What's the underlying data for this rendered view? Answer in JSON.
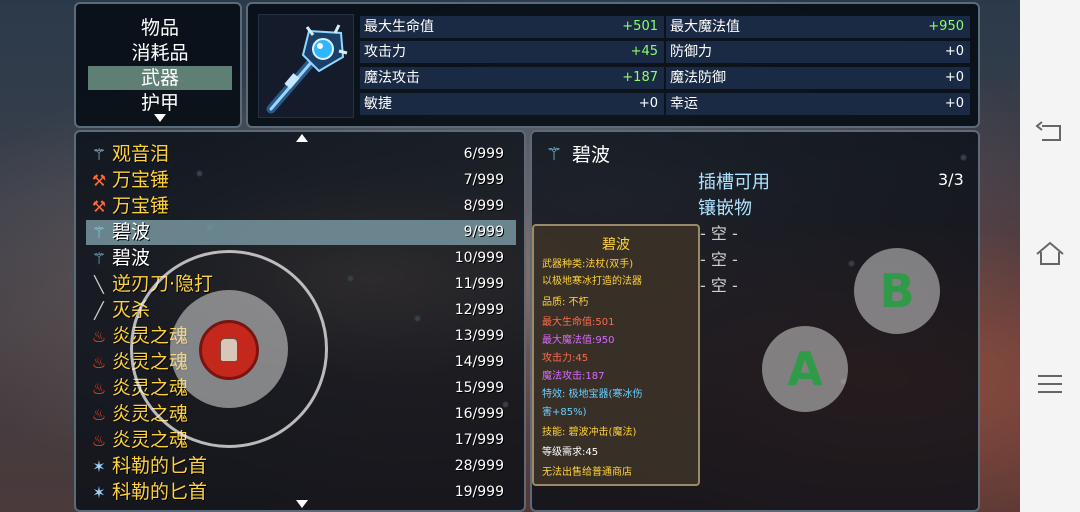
{
  "categories": {
    "items": [
      "物品",
      "消耗品",
      "武器",
      "护甲"
    ],
    "selected_index": 2
  },
  "stats": {
    "rows": [
      {
        "label": "最大生命值",
        "value": "+501"
      },
      {
        "label": "最大魔法值",
        "value": "+950"
      },
      {
        "label": "攻击力",
        "value": "+45"
      },
      {
        "label": "防御力",
        "value": "+0"
      },
      {
        "label": "魔法攻击",
        "value": "+187"
      },
      {
        "label": "魔法防御",
        "value": "+0"
      },
      {
        "label": "敏捷",
        "value": "+0"
      },
      {
        "label": "幸运",
        "value": "+0"
      }
    ]
  },
  "item_list": {
    "items": [
      {
        "icon": "orb-staff-icon",
        "name": "观音泪",
        "count": "6/999"
      },
      {
        "icon": "hammer-icon",
        "name": "万宝锤",
        "count": "7/999"
      },
      {
        "icon": "hammer-icon",
        "name": "万宝锤",
        "count": "8/999"
      },
      {
        "icon": "ice-staff-icon",
        "name": "碧波",
        "count": "9/999"
      },
      {
        "icon": "ice-staff-icon",
        "name": "碧波",
        "count": "10/999"
      },
      {
        "icon": "sword-icon",
        "name": "逆刃刀·隐打",
        "count": "11/999"
      },
      {
        "icon": "sword-icon",
        "name": "灭杀",
        "count": "12/999"
      },
      {
        "icon": "flame-soul-icon",
        "name": "炎灵之魂",
        "count": "13/999"
      },
      {
        "icon": "flame-soul-icon",
        "name": "炎灵之魂",
        "count": "14/999"
      },
      {
        "icon": "flame-soul-icon",
        "name": "炎灵之魂",
        "count": "15/999"
      },
      {
        "icon": "flame-soul-icon",
        "name": "炎灵之魂",
        "count": "16/999"
      },
      {
        "icon": "flame-soul-icon",
        "name": "炎灵之魂",
        "count": "17/999"
      },
      {
        "icon": "dagger-icon",
        "name": "科勒的匕首",
        "count": "28/999"
      },
      {
        "icon": "dagger-icon",
        "name": "科勒的匕首",
        "count": "19/999"
      }
    ],
    "selected_index": 3
  },
  "detail": {
    "name": "碧波",
    "slot_label_1": "插槽可用",
    "slot_label_2": "镶嵌物",
    "slot_count": "3/3",
    "slots": [
      "- 空 -",
      "- 空 -",
      "- 空 -"
    ]
  },
  "tooltip": {
    "title": "碧波",
    "lines": [
      {
        "text": "武器种类:法杖(双手)",
        "color": "#ffd23a"
      },
      {
        "text": "以极地寒冰打造的法器",
        "color": "#ffd23a"
      },
      {
        "text": "品质: 不朽",
        "color": "#ffd23a"
      },
      {
        "text": "最大生命值:501",
        "color": "#ff6a4a"
      },
      {
        "text": "最大魔法值:950",
        "color": "#d86aff"
      },
      {
        "text": "攻击力:45",
        "color": "#ff6a4a"
      },
      {
        "text": "魔法攻击:187",
        "color": "#d86aff"
      },
      {
        "text": "特效: 极地宝器(寒冰伤",
        "color": "#6ad0ff"
      },
      {
        "text": "害+85%)",
        "color": "#6ad0ff"
      },
      {
        "text": "技能: 碧波冲击(魔法)",
        "color": "#ffd23a"
      },
      {
        "text": "等级需求:45",
        "color": "#ffffff"
      },
      {
        "text": "无法出售给普通商店",
        "color": "#ffd23a"
      }
    ]
  },
  "controls": {
    "button_a": "A",
    "button_b": "B"
  },
  "navbar": {
    "icons": [
      "back-icon",
      "home-icon",
      "menu-icon"
    ]
  }
}
